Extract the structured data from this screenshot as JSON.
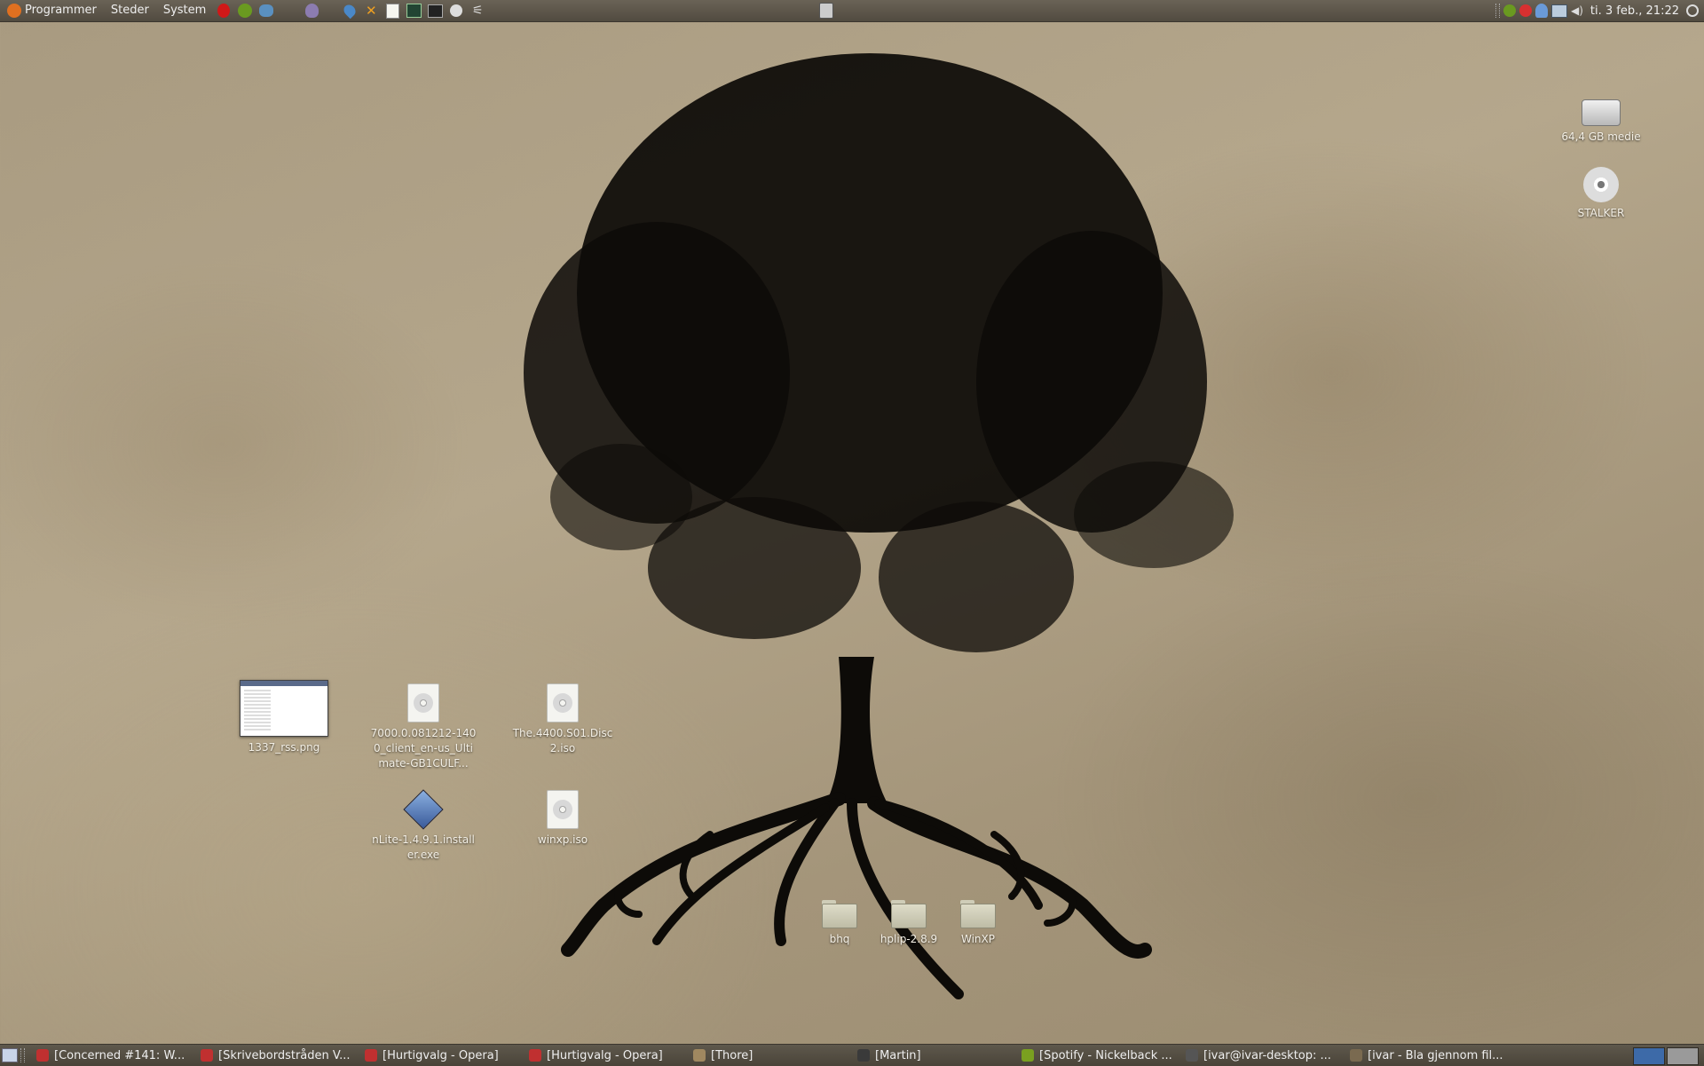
{
  "top_panel": {
    "menus": [
      "Programmer",
      "Steder",
      "System"
    ],
    "launchers": [
      "opera-icon",
      "spotify-icon",
      "pidgin-icon",
      "pidgin-bird-icon",
      "drop-icon",
      "tools-icon",
      "text-editor-icon",
      "system-monitor-icon",
      "terminal-icon",
      "disk-icon",
      "network-icon"
    ],
    "center_applet": "clipboard-icon",
    "tray": [
      "spotify-tray-icon",
      "opera-tray-icon",
      "user-icon",
      "network-tray-icon",
      "volume-icon"
    ],
    "clock": "ti.  3 feb., 21:22",
    "power": "power-icon"
  },
  "desktop": {
    "drives": [
      {
        "label": "64,4 GB medie",
        "icon": "hard-drive-icon"
      },
      {
        "label": "STALKER",
        "icon": "cd-icon"
      }
    ],
    "files": [
      {
        "label": "1337_rss.png",
        "icon": "image-thumbnail"
      },
      {
        "label": "7000.0.081212-1400_client_en-us_Ultimate-GB1CULF...",
        "icon": "disc-image-icon"
      },
      {
        "label": "The.4400.S01.Disc2.iso",
        "icon": "disc-image-icon"
      },
      {
        "label": "nLite-1.4.9.1.installer.exe",
        "icon": "executable-icon"
      },
      {
        "label": "winxp.iso",
        "icon": "disc-image-icon"
      },
      {
        "label": "bhq",
        "icon": "folder-icon"
      },
      {
        "label": "hplip-2.8.9",
        "icon": "folder-icon"
      },
      {
        "label": "WinXP",
        "icon": "folder-icon"
      }
    ]
  },
  "taskbar": {
    "tasks": [
      {
        "label": "[Concerned #141: W...",
        "color": "#c03030"
      },
      {
        "label": "[Skrivebordstråden V...",
        "color": "#c03030"
      },
      {
        "label": "[Hurtigvalg - Opera]",
        "color": "#c03030"
      },
      {
        "label": "[Hurtigvalg - Opera]",
        "color": "#c03030"
      },
      {
        "label": "[Thore]",
        "color": "#a08860"
      },
      {
        "label": "[Martin]",
        "color": "#3a3a3a"
      },
      {
        "label": "[Spotify - Nickelback ...",
        "color": "#7aa020"
      },
      {
        "label": "[ivar@ivar-desktop: ...",
        "color": "#555555"
      },
      {
        "label": "[ivar - Bla gjennom fil...",
        "color": "#7a6a50"
      }
    ],
    "workspaces": [
      "active",
      "inactive"
    ]
  }
}
